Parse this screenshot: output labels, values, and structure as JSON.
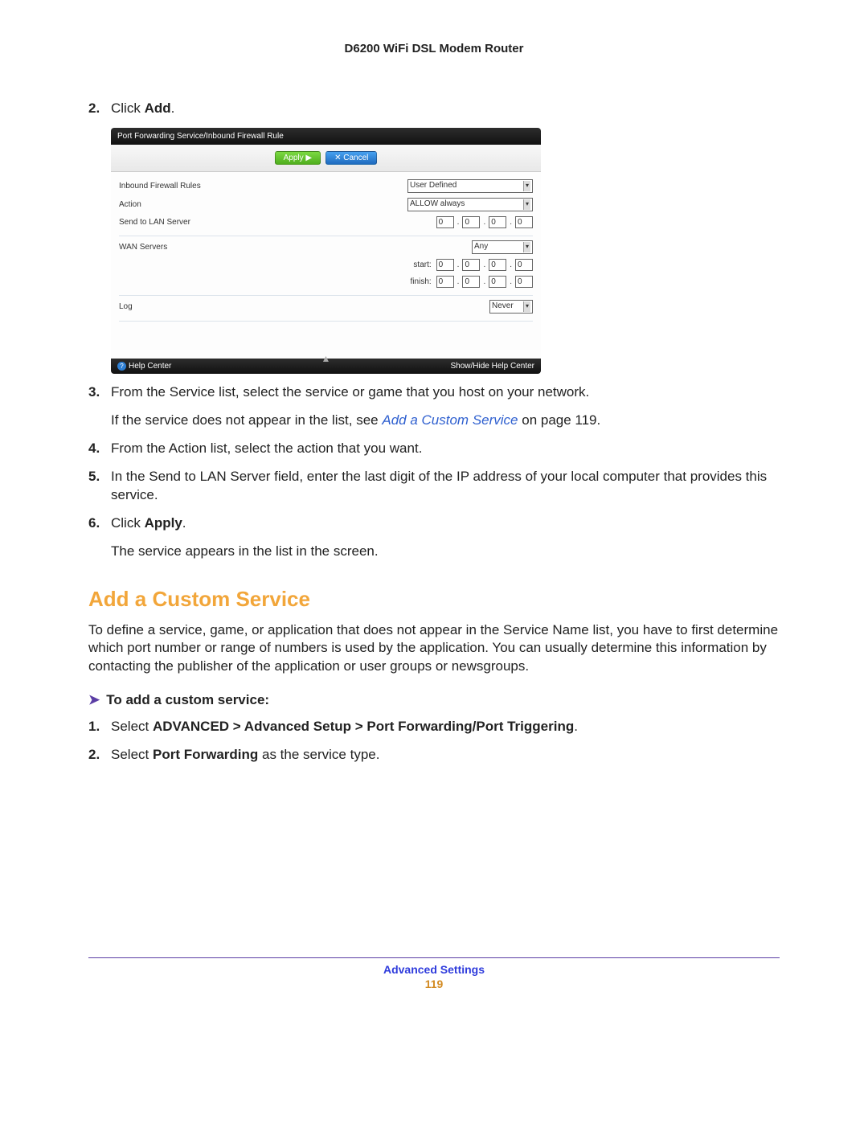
{
  "header": {
    "title": "D6200 WiFi DSL Modem Router"
  },
  "steps_a": [
    {
      "num": "2.",
      "prefix": "Click ",
      "bold": "Add",
      "suffix": "."
    }
  ],
  "router": {
    "title": "Port Forwarding Service/Inbound Firewall Rule",
    "apply": "Apply ▶",
    "cancel": "✕ Cancel",
    "rows": {
      "inbound_label": "Inbound Firewall Rules",
      "inbound_value": "User Defined",
      "action_label": "Action",
      "action_value": "ALLOW always",
      "sendlan_label": "Send to LAN Server",
      "wan_label": "WAN Servers",
      "wan_value": "Any",
      "start_label": "start:",
      "finish_label": "finish:",
      "log_label": "Log",
      "log_value": "Never"
    },
    "ip_zero": "0",
    "help_left": "Help Center",
    "help_right": "Show/Hide Help Center"
  },
  "steps_b": [
    {
      "num": "3.",
      "text": "From the Service list, select the service or game that you host on your network."
    },
    {
      "indent": true,
      "parts": [
        {
          "t": "If the service does not appear in the list, see "
        },
        {
          "link": "Add a Custom Service"
        },
        {
          "t": " on page 119."
        }
      ]
    },
    {
      "num": "4.",
      "text": "From the Action list, select the action that you want."
    },
    {
      "num": "5.",
      "text": "In the Send to LAN Server field, enter the last digit of the IP address of your local computer that provides this service."
    },
    {
      "num": "6.",
      "prefix": "Click ",
      "bold": "Apply",
      "suffix": "."
    },
    {
      "indent": true,
      "text": "The service appears in the list in the screen."
    }
  ],
  "section": {
    "heading": "Add a Custom Service",
    "para": "To define a service, game, or application that does not appear in the Service Name list, you have to first determine which port number or range of numbers is used by the application. You can usually determine this information by contacting the publisher of the application or user groups or newsgroups.",
    "task_head": "To add a custom service:",
    "steps": [
      {
        "num": "1.",
        "prefix": "Select ",
        "bold": "ADVANCED > Advanced Setup > Port Forwarding/Port Triggering",
        "suffix": "."
      },
      {
        "num": "2.",
        "prefix": "Select ",
        "bold": "Port Forwarding",
        "suffix": " as the service type."
      }
    ]
  },
  "footer": {
    "text": "Advanced Settings",
    "page": "119"
  }
}
